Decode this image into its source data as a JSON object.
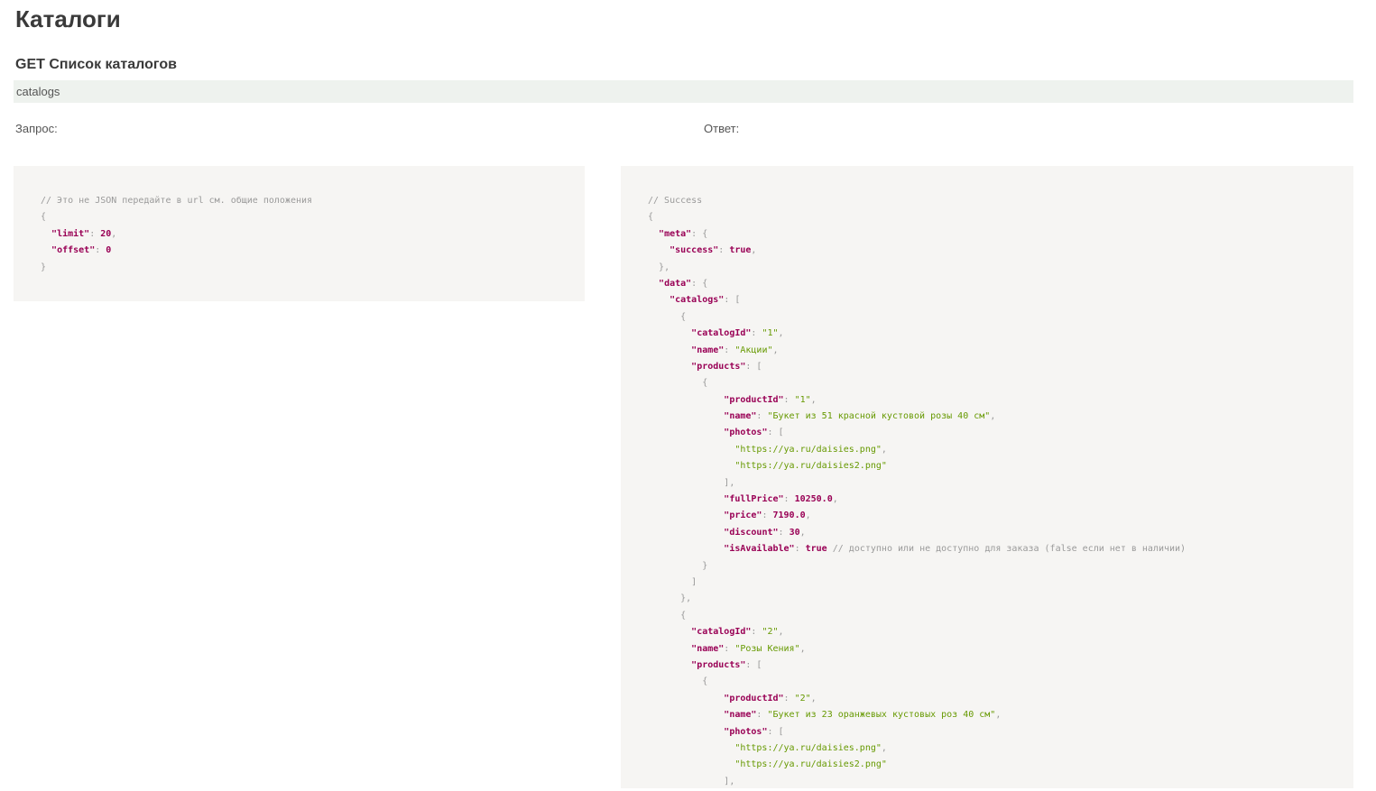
{
  "page": {
    "title": "Каталоги"
  },
  "endpoint": {
    "title": "GET Список каталогов",
    "path": "catalogs"
  },
  "request": {
    "label": "Запрос:",
    "lines": [
      [
        [
          "comment",
          "// Это не JSON передайте в url см. общие положения"
        ]
      ],
      [
        [
          "punct",
          "{"
        ]
      ],
      [
        [
          "indent",
          "  "
        ],
        [
          "key",
          "\"limit\""
        ],
        [
          "punct",
          ": "
        ],
        [
          "literal",
          "20"
        ],
        [
          "punct",
          ","
        ]
      ],
      [
        [
          "indent",
          "  "
        ],
        [
          "key",
          "\"offset\""
        ],
        [
          "punct",
          ": "
        ],
        [
          "literal",
          "0"
        ]
      ],
      [
        [
          "punct",
          "}"
        ]
      ]
    ]
  },
  "response": {
    "label": "Ответ:",
    "lines": [
      [
        [
          "comment",
          "// Success"
        ]
      ],
      [
        [
          "punct",
          "{"
        ]
      ],
      [
        [
          "indent",
          "  "
        ],
        [
          "key",
          "\"meta\""
        ],
        [
          "punct",
          ": {"
        ]
      ],
      [
        [
          "indent",
          "    "
        ],
        [
          "key",
          "\"success\""
        ],
        [
          "punct",
          ": "
        ],
        [
          "literal",
          "true"
        ],
        [
          "punct",
          ","
        ]
      ],
      [
        [
          "indent",
          "  "
        ],
        [
          "punct",
          "},"
        ]
      ],
      [
        [
          "indent",
          "  "
        ],
        [
          "key",
          "\"data\""
        ],
        [
          "punct",
          ": {"
        ]
      ],
      [
        [
          "indent",
          "    "
        ],
        [
          "key",
          "\"catalogs\""
        ],
        [
          "punct",
          ": ["
        ]
      ],
      [
        [
          "indent",
          "      "
        ],
        [
          "punct",
          "{"
        ]
      ],
      [
        [
          "indent",
          "        "
        ],
        [
          "key",
          "\"catalogId\""
        ],
        [
          "punct",
          ": "
        ],
        [
          "string",
          "\"1\""
        ],
        [
          "punct",
          ","
        ]
      ],
      [
        [
          "indent",
          "        "
        ],
        [
          "key",
          "\"name\""
        ],
        [
          "punct",
          ": "
        ],
        [
          "string",
          "\"Акции\""
        ],
        [
          "punct",
          ","
        ]
      ],
      [
        [
          "indent",
          "        "
        ],
        [
          "key",
          "\"products\""
        ],
        [
          "punct",
          ": ["
        ]
      ],
      [
        [
          "indent",
          "          "
        ],
        [
          "punct",
          "{"
        ]
      ],
      [
        [
          "indent",
          "              "
        ],
        [
          "key",
          "\"productId\""
        ],
        [
          "punct",
          ": "
        ],
        [
          "string",
          "\"1\""
        ],
        [
          "punct",
          ","
        ]
      ],
      [
        [
          "indent",
          "              "
        ],
        [
          "key",
          "\"name\""
        ],
        [
          "punct",
          ": "
        ],
        [
          "string",
          "\"Букет из 51 красной кустовой розы 40 см\""
        ],
        [
          "punct",
          ","
        ]
      ],
      [
        [
          "indent",
          "              "
        ],
        [
          "key",
          "\"photos\""
        ],
        [
          "punct",
          ": ["
        ]
      ],
      [
        [
          "indent",
          "                "
        ],
        [
          "string",
          "\"https://ya.ru/daisies.png\""
        ],
        [
          "punct",
          ","
        ]
      ],
      [
        [
          "indent",
          "                "
        ],
        [
          "string",
          "\"https://ya.ru/daisies2.png\""
        ]
      ],
      [
        [
          "indent",
          "              "
        ],
        [
          "punct",
          "],"
        ]
      ],
      [
        [
          "indent",
          "              "
        ],
        [
          "key",
          "\"fullPrice\""
        ],
        [
          "punct",
          ": "
        ],
        [
          "literal",
          "10250.0"
        ],
        [
          "punct",
          ","
        ]
      ],
      [
        [
          "indent",
          "              "
        ],
        [
          "key",
          "\"price\""
        ],
        [
          "punct",
          ": "
        ],
        [
          "literal",
          "7190.0"
        ],
        [
          "punct",
          ","
        ]
      ],
      [
        [
          "indent",
          "              "
        ],
        [
          "key",
          "\"discount\""
        ],
        [
          "punct",
          ": "
        ],
        [
          "literal",
          "30"
        ],
        [
          "punct",
          ","
        ]
      ],
      [
        [
          "indent",
          "              "
        ],
        [
          "key",
          "\"isAvailable\""
        ],
        [
          "punct",
          ": "
        ],
        [
          "literal",
          "true"
        ],
        [
          "comment",
          " // доступно или не доступно для заказа (false если нет в наличии)"
        ]
      ],
      [
        [
          "indent",
          "          "
        ],
        [
          "punct",
          "}"
        ]
      ],
      [
        [
          "indent",
          "        "
        ],
        [
          "punct",
          "]"
        ]
      ],
      [
        [
          "indent",
          "      "
        ],
        [
          "punct",
          "},"
        ]
      ],
      [
        [
          "indent",
          "      "
        ],
        [
          "punct",
          "{"
        ]
      ],
      [
        [
          "indent",
          "        "
        ],
        [
          "key",
          "\"catalogId\""
        ],
        [
          "punct",
          ": "
        ],
        [
          "string",
          "\"2\""
        ],
        [
          "punct",
          ","
        ]
      ],
      [
        [
          "indent",
          "        "
        ],
        [
          "key",
          "\"name\""
        ],
        [
          "punct",
          ": "
        ],
        [
          "string",
          "\"Розы Кения\""
        ],
        [
          "punct",
          ","
        ]
      ],
      [
        [
          "indent",
          "        "
        ],
        [
          "key",
          "\"products\""
        ],
        [
          "punct",
          ": ["
        ]
      ],
      [
        [
          "indent",
          "          "
        ],
        [
          "punct",
          "{"
        ]
      ],
      [
        [
          "indent",
          "              "
        ],
        [
          "key",
          "\"productId\""
        ],
        [
          "punct",
          ": "
        ],
        [
          "string",
          "\"2\""
        ],
        [
          "punct",
          ","
        ]
      ],
      [
        [
          "indent",
          "              "
        ],
        [
          "key",
          "\"name\""
        ],
        [
          "punct",
          ": "
        ],
        [
          "string",
          "\"Букет из 23 оранжевых кустовых роз 40 см\""
        ],
        [
          "punct",
          ","
        ]
      ],
      [
        [
          "indent",
          "              "
        ],
        [
          "key",
          "\"photos\""
        ],
        [
          "punct",
          ": ["
        ]
      ],
      [
        [
          "indent",
          "                "
        ],
        [
          "string",
          "\"https://ya.ru/daisies.png\""
        ],
        [
          "punct",
          ","
        ]
      ],
      [
        [
          "indent",
          "                "
        ],
        [
          "string",
          "\"https://ya.ru/daisies2.png\""
        ]
      ],
      [
        [
          "indent",
          "              "
        ],
        [
          "punct",
          "],"
        ]
      ]
    ]
  }
}
